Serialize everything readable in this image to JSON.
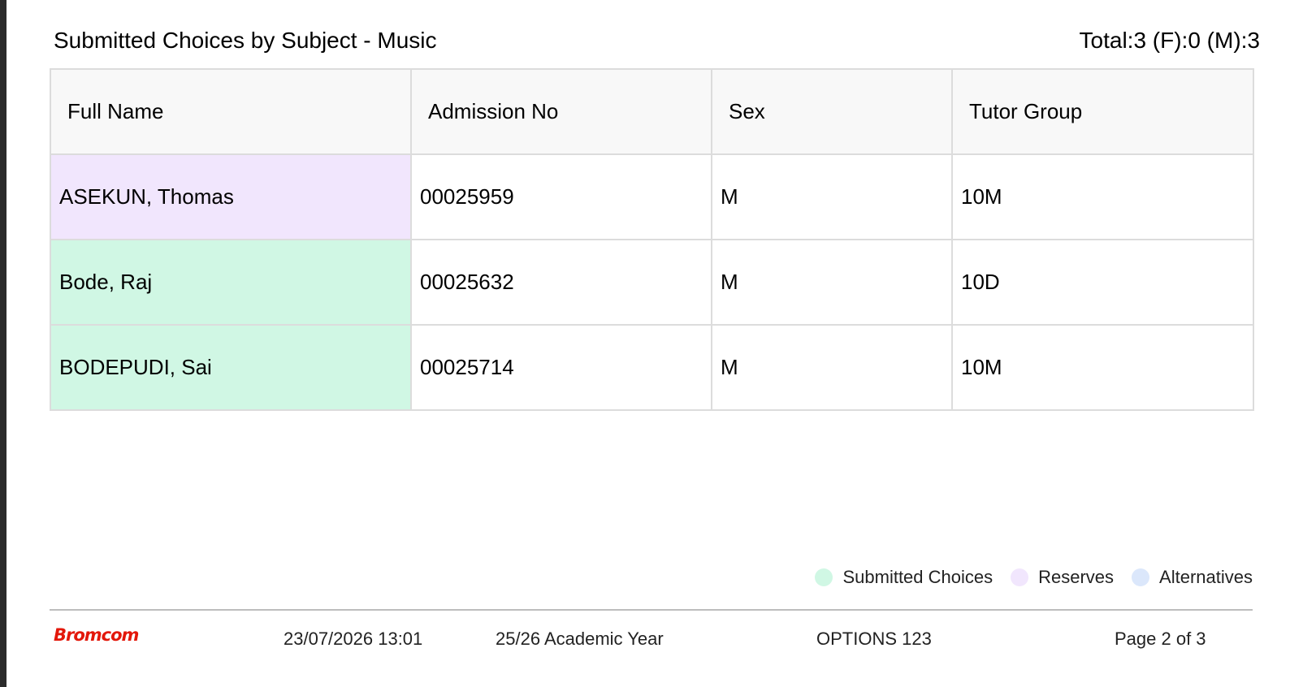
{
  "report": {
    "title": "Submitted Choices by Subject - Music",
    "totals": "Total:3 (F):0 (M):3"
  },
  "table": {
    "headers": [
      "Full Name",
      "Admission No",
      "Sex",
      "Tutor Group"
    ],
    "rows": [
      {
        "full_name": "ASEKUN, Thomas",
        "admission_no": "00025959",
        "sex": "M",
        "tutor_group": "10M",
        "status": "reserve"
      },
      {
        "full_name": "Bode, Raj",
        "admission_no": "00025632",
        "sex": "M",
        "tutor_group": "10D",
        "status": "submitted"
      },
      {
        "full_name": "BODEPUDI, Sai",
        "admission_no": "00025714",
        "sex": "M",
        "tutor_group": "10M",
        "status": "submitted"
      }
    ]
  },
  "legend": [
    {
      "label": "Submitted Choices",
      "color": "#d0f7e4"
    },
    {
      "label": "Reserves",
      "color": "#f1e6fd"
    },
    {
      "label": "Alternatives",
      "color": "#dbe7fb"
    }
  ],
  "status_colors": {
    "submitted": "#d0f7e4",
    "reserve": "#f1e6fd",
    "alternative": "#dbe7fb"
  },
  "footer": {
    "brand": "Bromcom",
    "timestamp": "23/07/2026 13:01",
    "academic_year": "25/26 Academic Year",
    "module": "OPTIONS 123",
    "page": "Page 2 of 3"
  }
}
